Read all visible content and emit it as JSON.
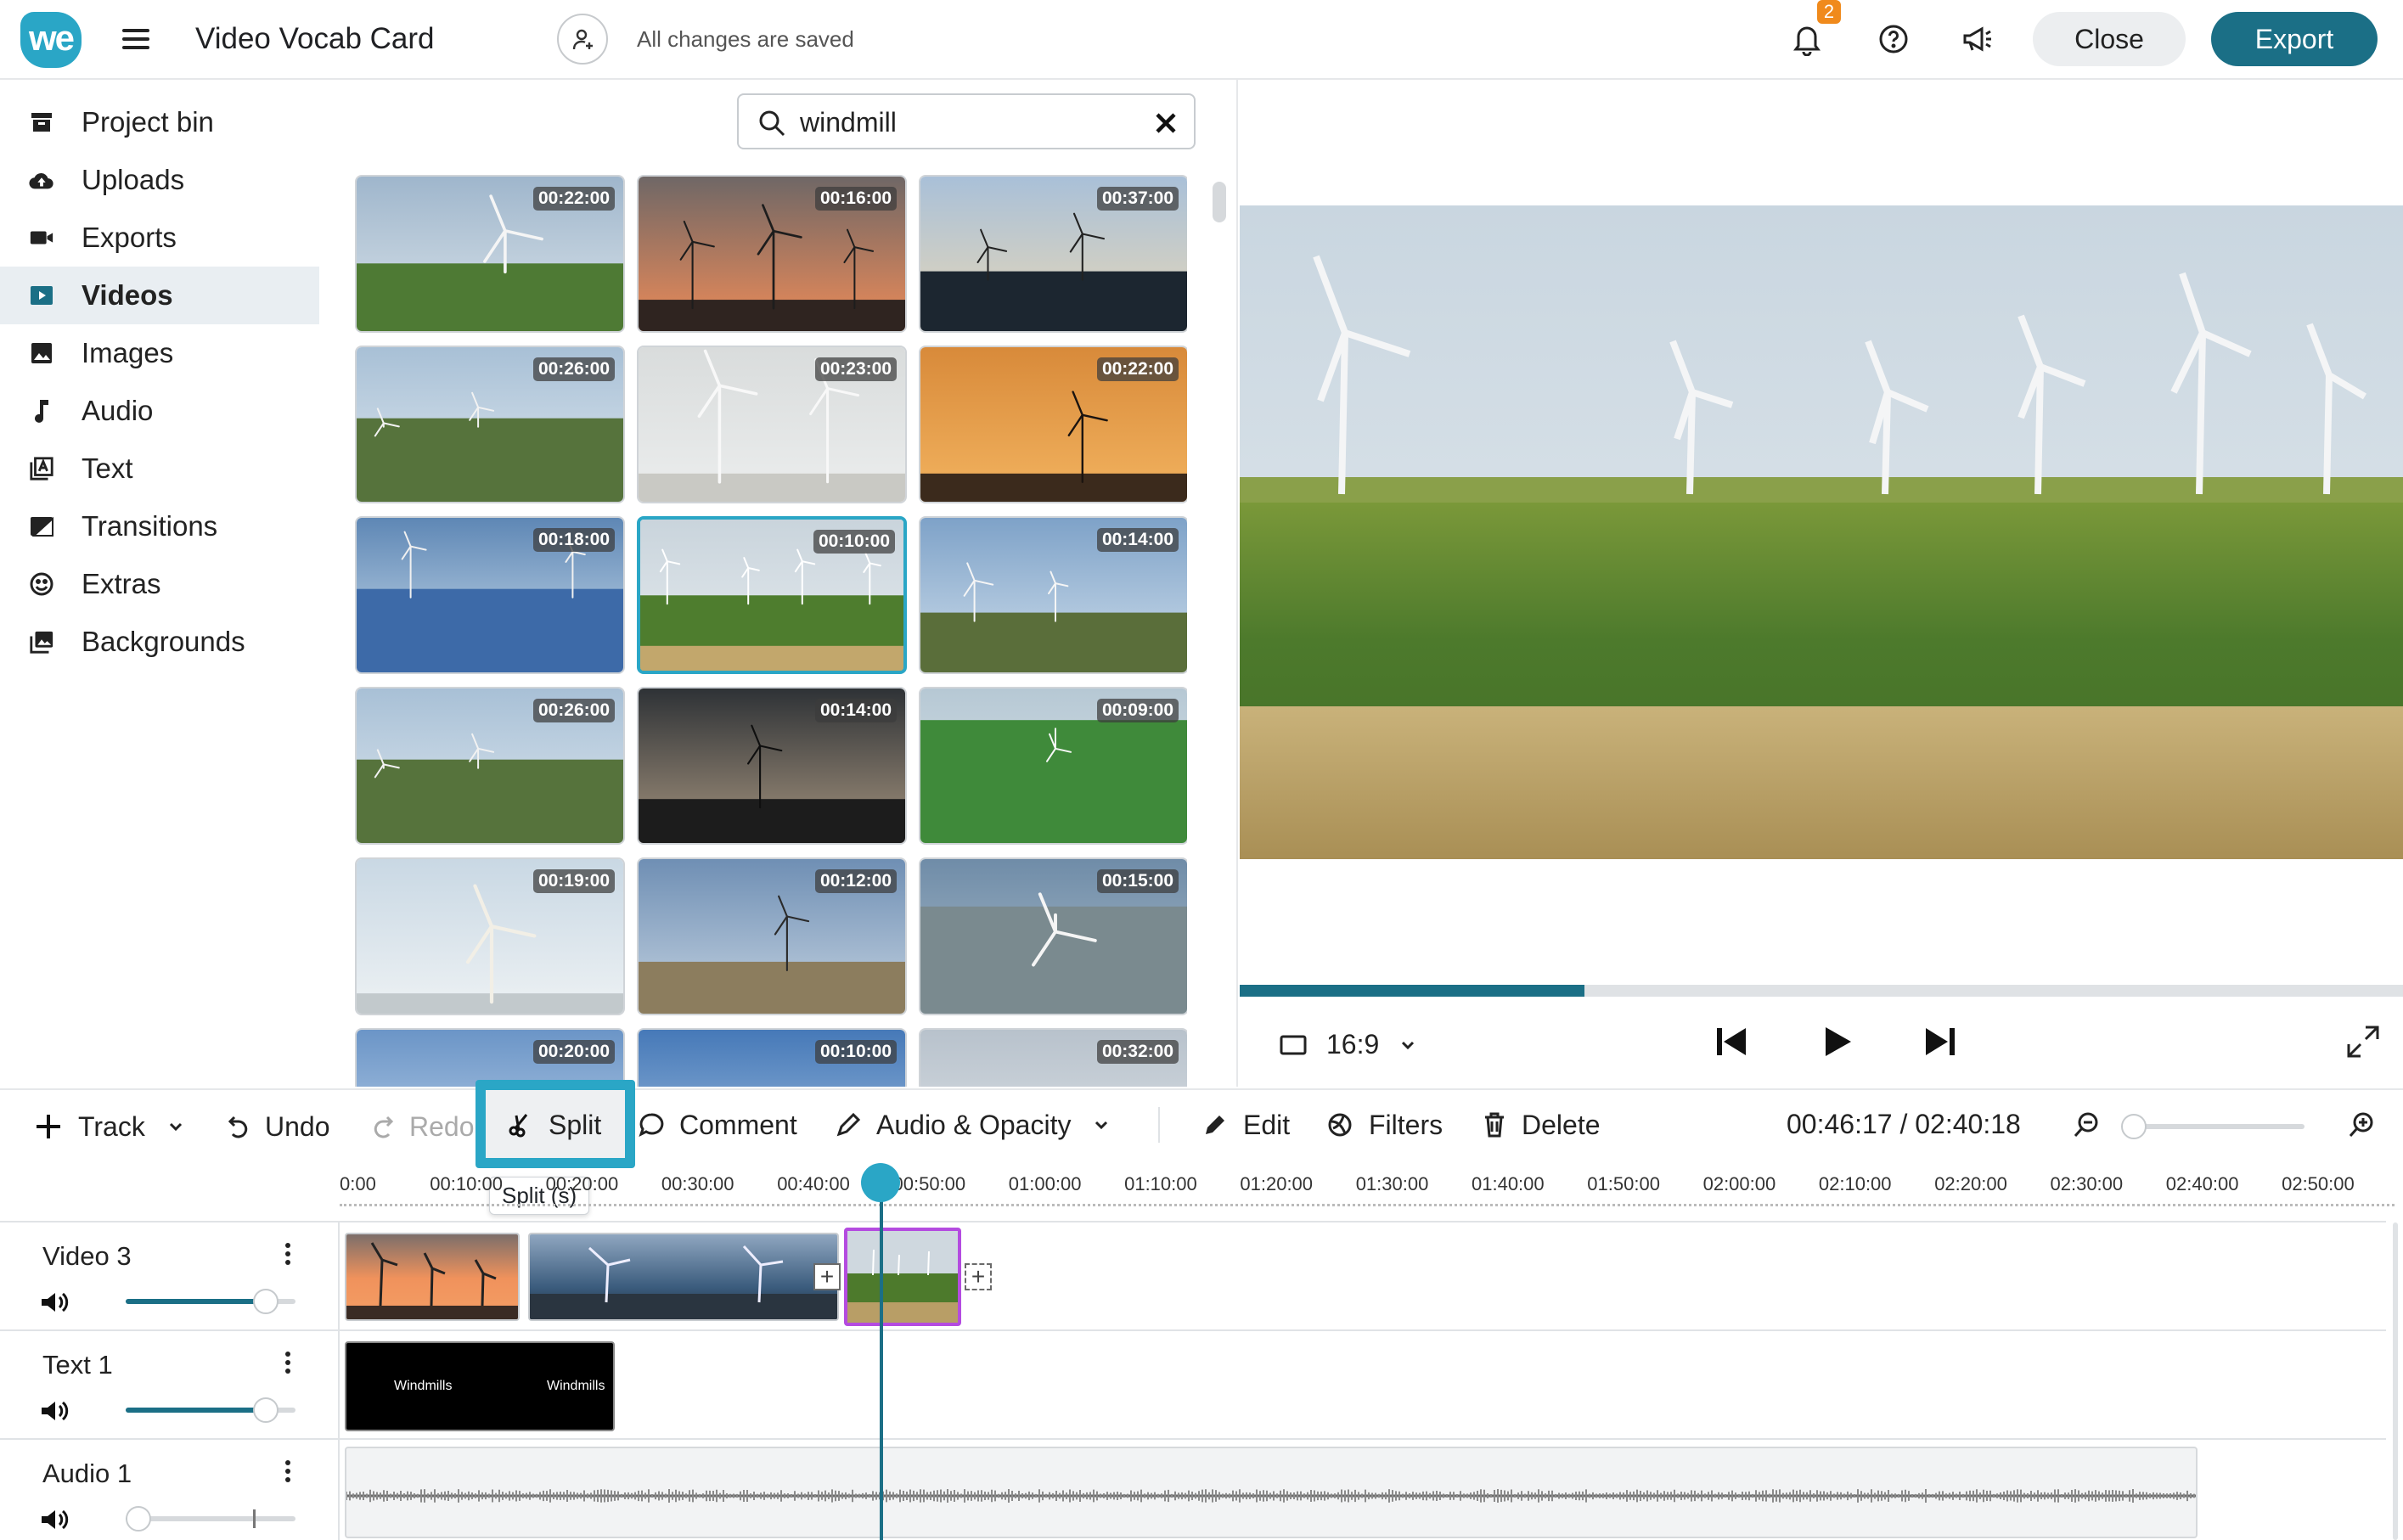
{
  "app": {
    "logo": "we",
    "title": "Video Vocab Card",
    "save_status": "All changes are saved",
    "notification_count": "2",
    "close_label": "Close",
    "export_label": "Export"
  },
  "sidebar": {
    "items": [
      {
        "label": "Project bin",
        "icon": "archive-icon"
      },
      {
        "label": "Uploads",
        "icon": "cloud-upload-icon"
      },
      {
        "label": "Exports",
        "icon": "video-camera-icon"
      },
      {
        "label": "Videos",
        "icon": "video-play-icon",
        "active": true
      },
      {
        "label": "Images",
        "icon": "image-icon"
      },
      {
        "label": "Audio",
        "icon": "music-note-icon"
      },
      {
        "label": "Text",
        "icon": "text-icon"
      },
      {
        "label": "Transitions",
        "icon": "transition-icon"
      },
      {
        "label": "Extras",
        "icon": "smiley-icon"
      },
      {
        "label": "Backgrounds",
        "icon": "backgrounds-icon"
      }
    ]
  },
  "search": {
    "value": "windmill",
    "placeholder": ""
  },
  "results": [
    {
      "duration": "00:22:00",
      "scene": "green-hills-turbine"
    },
    {
      "duration": "00:16:00",
      "scene": "orange-sunset"
    },
    {
      "duration": "00:37:00",
      "scene": "coast-sunset"
    },
    {
      "duration": "00:26:00",
      "scene": "mountain-ridge"
    },
    {
      "duration": "00:23:00",
      "scene": "grey-poles"
    },
    {
      "duration": "00:22:00",
      "scene": "orange-windmill"
    },
    {
      "duration": "00:18:00",
      "scene": "solar-panels"
    },
    {
      "duration": "00:10:00",
      "scene": "field-turbines",
      "selected": true
    },
    {
      "duration": "00:14:00",
      "scene": "sea-cliff"
    },
    {
      "duration": "00:26:00",
      "scene": "mountain-ridge"
    },
    {
      "duration": "00:14:00",
      "scene": "dark-sunset"
    },
    {
      "duration": "00:09:00",
      "scene": "aerial-fields"
    },
    {
      "duration": "00:19:00",
      "scene": "turbine-closeup"
    },
    {
      "duration": "00:12:00",
      "scene": "reeds-windmill"
    },
    {
      "duration": "00:15:00",
      "scene": "aerial-blades"
    },
    {
      "duration": "00:20:00",
      "scene": "sky-blur"
    },
    {
      "duration": "00:10:00",
      "scene": "blue-sky"
    },
    {
      "duration": "00:32:00",
      "scene": "river-town"
    }
  ],
  "player": {
    "aspect_ratio": "16:9",
    "progress": 0.296
  },
  "toolbar": {
    "track": "Track",
    "undo": "Undo",
    "redo": "Redo",
    "split": "Split",
    "comment": "Comment",
    "audio_opacity": "Audio & Opacity",
    "edit": "Edit",
    "filters": "Filters",
    "delete": "Delete",
    "split_tooltip": "Split (s)",
    "timecode": "00:46:17 / 02:40:18"
  },
  "ruler": {
    "labels": [
      "0:00",
      "00:10:00",
      "00:20:00",
      "00:30:00",
      "00:40:00",
      "00:50:00",
      "01:00:00",
      "01:10:00",
      "01:20:00",
      "01:30:00",
      "01:40:00",
      "01:50:00",
      "02:00:00",
      "02:10:00",
      "02:20:00",
      "02:30:00",
      "02:40:00",
      "02:50:00"
    ]
  },
  "tracks": [
    {
      "name": "Video 3",
      "volume": 0.82
    },
    {
      "name": "Text 1",
      "volume": 0.82
    },
    {
      "name": "Audio 1",
      "volume": 0.07
    }
  ],
  "text_clip": {
    "left_label": "Windmills",
    "right_label": "Windmills"
  },
  "colors": {
    "accent": "#2aa6c6",
    "primary": "#1b6f86",
    "selection": "#b44be0"
  }
}
